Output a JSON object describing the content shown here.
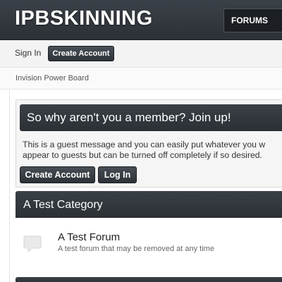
{
  "header": {
    "logo": "IPBSKINNING",
    "nav_tab": "FORUMS"
  },
  "userbar": {
    "sign_in": "Sign In",
    "create_account": "Create Account"
  },
  "breadcrumb": {
    "label": "Invision Power Board"
  },
  "guest_message": {
    "title": "So why aren't you a member? Join up!",
    "line1": "This is a guest message and you can easily put whatever you w",
    "line2": "appear to guests but can be turned off completely if so desired.",
    "create_button": "Create Account",
    "login_button": "Log In"
  },
  "category": {
    "title": "A Test Category",
    "forums": [
      {
        "name": "A Test Forum",
        "description": "A test forum that may be removed at any time",
        "icon": "forum-bubble-icon"
      }
    ]
  },
  "colors": {
    "header_dark": "#2c3136",
    "bar_dark": "#3a4047",
    "button_dark": "#2e3338",
    "text": "#333333"
  }
}
